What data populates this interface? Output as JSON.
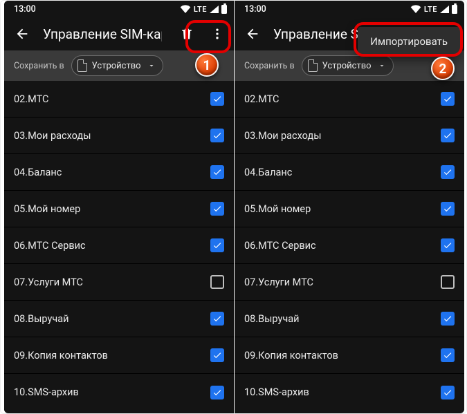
{
  "status": {
    "time": "13:00",
    "network": "LTE"
  },
  "appbar": {
    "title_left": "Управление SIM-картой",
    "title_right": "Управление SI"
  },
  "chipbar": {
    "label": "Сохранить в",
    "device": "Устройство"
  },
  "popup": {
    "import": "Импортировать"
  },
  "contacts": [
    {
      "name": "02.МТС",
      "checked": true
    },
    {
      "name": "03.Мои расходы",
      "checked": true
    },
    {
      "name": "04.Баланс",
      "checked": true
    },
    {
      "name": "05.Мой номер",
      "checked": true
    },
    {
      "name": "06.МТС Сервис",
      "checked": true
    },
    {
      "name": "07.Услуги МТС",
      "checked": false
    },
    {
      "name": "08.Выручай",
      "checked": true
    },
    {
      "name": "09.Копия контактов",
      "checked": true
    },
    {
      "name": "10.SMS-архив",
      "checked": true
    }
  ],
  "badges": {
    "left": "1",
    "right": "2"
  },
  "colors": {
    "accent": "#1f73ef",
    "callout": "#e30000"
  }
}
